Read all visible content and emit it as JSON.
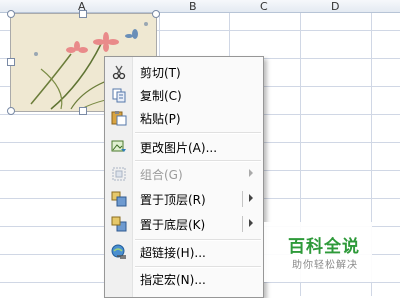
{
  "columns": [
    "A",
    "B",
    "C",
    "D"
  ],
  "menu": {
    "items": [
      {
        "label": "剪切(T)",
        "icon": "scissors-icon",
        "enabled": true,
        "submenu": false
      },
      {
        "label": "复制(C)",
        "icon": "copy-icon",
        "enabled": true,
        "submenu": false
      },
      {
        "label": "粘贴(P)",
        "icon": "paste-icon",
        "enabled": true,
        "submenu": false
      },
      {
        "label": "更改图片(A)...",
        "icon": "change-picture-icon",
        "enabled": true,
        "submenu": false
      },
      {
        "label": "组合(G)",
        "icon": "group-icon",
        "enabled": false,
        "submenu": true
      },
      {
        "label": "置于顶层(R)",
        "icon": "bring-to-front-icon",
        "enabled": true,
        "submenu": true
      },
      {
        "label": "置于底层(K)",
        "icon": "send-to-back-icon",
        "enabled": true,
        "submenu": true
      },
      {
        "label": "超链接(H)...",
        "icon": "hyperlink-icon",
        "enabled": true,
        "submenu": false
      },
      {
        "label": "指定宏(N)...",
        "icon": "",
        "enabled": true,
        "submenu": false
      }
    ]
  },
  "watermark": {
    "title": "百科全说",
    "tagline": "助你轻松解决"
  },
  "colors": {
    "grid": "#c7d3e3",
    "menu_bg": "#fafafa",
    "watermark_green": "#2e9a3a"
  }
}
